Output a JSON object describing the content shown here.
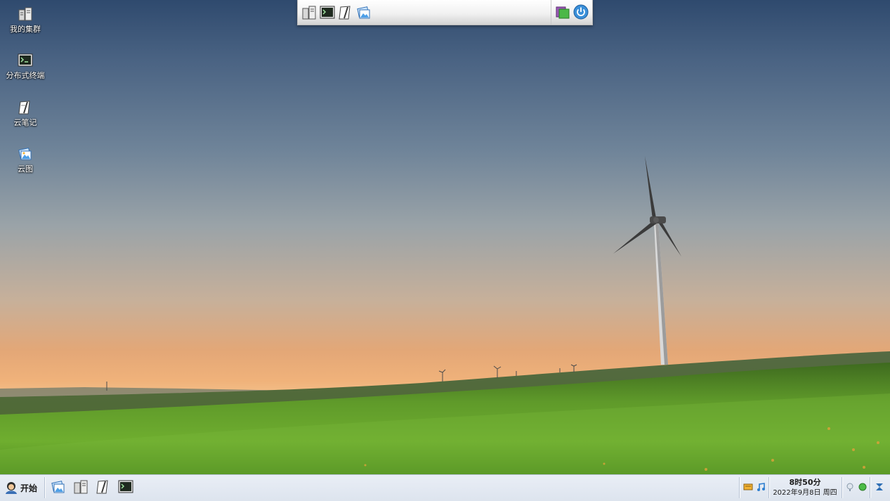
{
  "desktop": {
    "icons": [
      {
        "label": "我的集群",
        "icon": "cluster-servers-icon"
      },
      {
        "label": "分布式终端",
        "icon": "terminal-icon"
      },
      {
        "label": "云笔记",
        "icon": "notes-icon"
      },
      {
        "label": "云图",
        "icon": "cloud-image-icon"
      }
    ]
  },
  "top_dock": {
    "left_icons": [
      "cluster-servers-icon",
      "terminal-icon",
      "notes-icon",
      "cloud-image-icon"
    ],
    "right_icons": [
      "folder-icon",
      "power-icon"
    ]
  },
  "taskbar": {
    "start_label": "开始",
    "quick_launch": [
      "cloud-image-icon",
      "cluster-servers-icon",
      "notes-icon",
      "terminal-icon"
    ],
    "tray_icons": [
      "keyboard-icon",
      "music-icon",
      "network-icon",
      "status-green-icon"
    ],
    "clock": {
      "time": "8时50分",
      "date": "2022年9月8日 周四"
    }
  },
  "colors": {
    "taskbar_bg": "#dde4ee",
    "sky_top": "#2f4a6e",
    "horizon": "#f0b27a",
    "grass": "#5f9a2a"
  }
}
